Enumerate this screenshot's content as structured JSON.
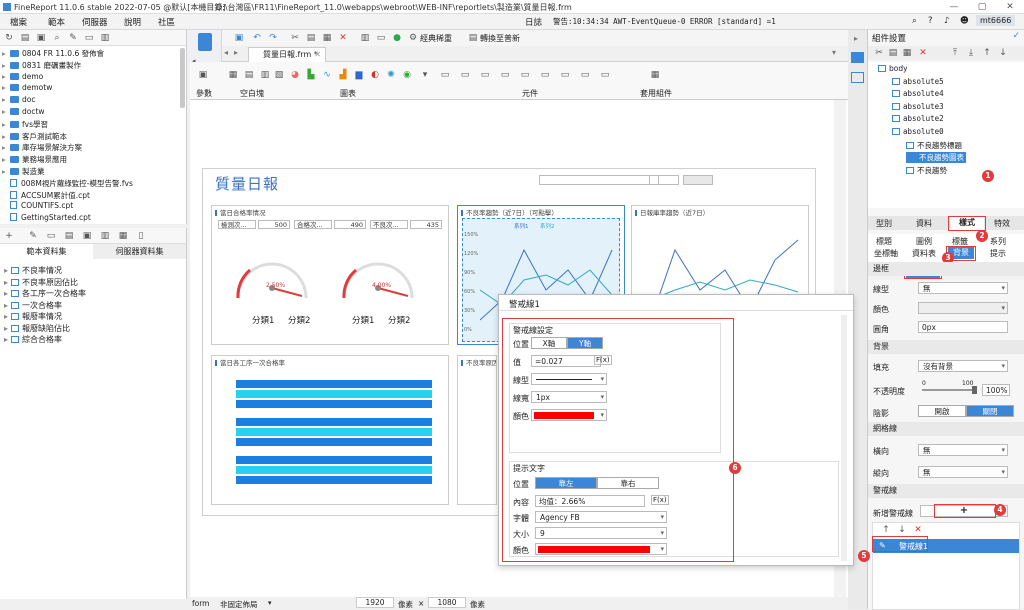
{
  "window": {
    "title": "FineReport 11.0.6 stable 2022-07-05 @默认[本機目錄]",
    "path": "D:\\台灣區\\FR11\\FineReport_11.0\\webapps\\webroot\\WEB-INF\\reportlets\\製造業\\質量日報.frm"
  },
  "menu": {
    "items": [
      "檔案",
      "範本",
      "伺服器",
      "說明",
      "社區"
    ],
    "log_label": "日誌",
    "log_text": "警告:10:34:34 AWT-EventQueue-0 ERROR [standard] =1",
    "user": "mt6666"
  },
  "file_tree": {
    "items": [
      {
        "label": "0804 FR 11.0.6 發佈會",
        "type": "folder"
      },
      {
        "label": "0831 磨礪畫製作",
        "type": "folder"
      },
      {
        "label": "demo",
        "type": "folder"
      },
      {
        "label": "demotw",
        "type": "folder"
      },
      {
        "label": "doc",
        "type": "folder"
      },
      {
        "label": "doctw",
        "type": "folder"
      },
      {
        "label": "fvs學習",
        "type": "folder"
      },
      {
        "label": "客戶測試範本",
        "type": "folder"
      },
      {
        "label": "庫存場景解決方案",
        "type": "folder"
      },
      {
        "label": "業務場景應用",
        "type": "folder"
      },
      {
        "label": "製造業",
        "type": "folder"
      },
      {
        "label": "008M視片蘿綠監控-模型告警.fvs",
        "type": "file"
      },
      {
        "label": "ACCSUM累計值.cpt",
        "type": "file"
      },
      {
        "label": "COUNTIFS.cpt",
        "type": "file"
      },
      {
        "label": "GettingStarted.cpt",
        "type": "file"
      }
    ]
  },
  "datasets": {
    "tabs": [
      "範本資料集",
      "伺服器資料集"
    ],
    "items": [
      "不良率情况",
      "不良率原因佔比",
      "各工序一次合格率",
      "一次合格率",
      "報廢率情况",
      "報廢缺陷佔比",
      "綜合合格率"
    ]
  },
  "editor": {
    "doc_tab": "質量日報.frm *",
    "toolbar_labels": [
      "經典稀重",
      "轉換至普新"
    ],
    "ribbon_groups": [
      "參數",
      "空白塊",
      "圖表",
      "元件",
      "套用組件"
    ]
  },
  "report": {
    "title": "質量日報",
    "panel1": {
      "title": "當日合格率情况",
      "kv": [
        {
          "k": "檢測次...",
          "v": "500"
        },
        {
          "k": "合格次...",
          "v": "490"
        },
        {
          "k": "不良次...",
          "v": "435"
        }
      ],
      "gauges": [
        {
          "value": "2.50%",
          "labels": [
            "分類1",
            "分類2"
          ]
        },
        {
          "value": "4.00%",
          "labels": [
            "分類1",
            "分類2"
          ]
        }
      ]
    },
    "panel2": {
      "title": "不良率趨勢（近7日）（可點擊）",
      "legend": [
        "系列1",
        "系列2"
      ],
      "yticks": [
        "150%",
        "120%",
        "90%",
        "60%",
        "30%",
        "0%"
      ]
    },
    "panel3": {
      "title": "日報庫率趨勢（近7日）"
    },
    "panel4": {
      "title": "當日各工序一次合格率"
    },
    "panel5": {
      "title": "不良率原因"
    }
  },
  "status": {
    "mode": "form",
    "layout": "非固定佈局",
    "width": "1920",
    "unit": "像素",
    "times": "×",
    "height": "1080"
  },
  "right": {
    "header": "組件設置",
    "tree": [
      "body",
      "absolute5",
      "absolute4",
      "absolute3",
      "absolute2",
      "absolute0",
      "不良趨勢標題",
      "不良趨勢圖表",
      "不良趨勢"
    ],
    "tabs": [
      "型別",
      "資料",
      "樣式",
      "特效"
    ],
    "subtabs": [
      "標題",
      "圖例",
      "標籤",
      "系列",
      "坐標軸",
      "資料表",
      "背景",
      "提示"
    ],
    "sub2": [
      "圖表區",
      "繪圖區"
    ],
    "sections": {
      "border": "邊框",
      "bg": "背景",
      "grid": "網格線",
      "alert": "警戒線"
    },
    "border": {
      "line_label": "線型",
      "line_val": "無",
      "color_label": "顏色",
      "radius_label": "圓角",
      "radius_val": "0px"
    },
    "bg": {
      "fill_label": "填充",
      "fill_val": "沒有背景",
      "opacity_label": "不透明度",
      "op_min": "0",
      "op_max": "100",
      "op_val": "100%",
      "shadow_label": "陰影",
      "shadow_on": "開啟",
      "shadow_off": "關閉"
    },
    "grid": {
      "h_label": "橫向",
      "h_val": "無",
      "v_label": "縱向",
      "v_val": "無"
    },
    "alert": {
      "add_label": "新增警戒線",
      "add_btn": "+",
      "item": "警戒線1"
    }
  },
  "dialog": {
    "title": "警戒線1",
    "setting": "警戒線設定",
    "pos_label": "位置",
    "pos_opts": [
      "X軸",
      "Y軸"
    ],
    "value_label": "值",
    "value": "=0.027",
    "linetype_label": "線型",
    "linewidth_label": "線寬",
    "linewidth": "1px",
    "color_label": "顏色",
    "tip_section": "提示文字",
    "tpos_label": "位置",
    "tpos_opts": [
      "靠左",
      "靠右"
    ],
    "content_label": "內容",
    "content": "均值：2.66%",
    "font_label": "字體",
    "font": "Agency FB",
    "size_label": "大小",
    "size": "9",
    "tcolor_label": "顏色"
  },
  "markers": [
    "1",
    "2",
    "3",
    "4",
    "5",
    "6"
  ],
  "colors": {
    "accent": "#3b86d6",
    "alert": "#ff0000",
    "mark": "#e23b3b"
  }
}
